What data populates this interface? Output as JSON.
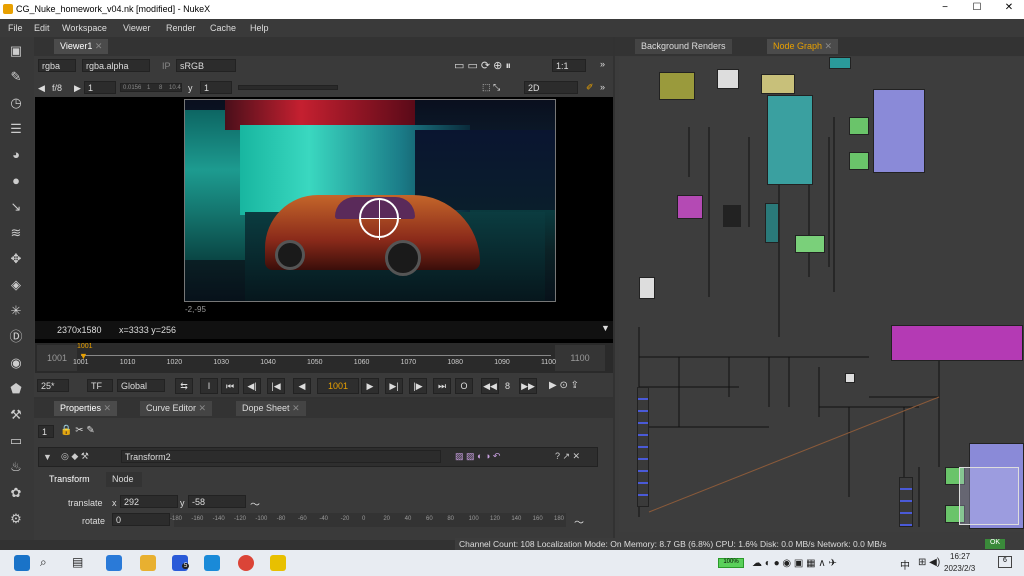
{
  "window": {
    "title": "CG_Nuke_homework_v04.nk [modified] - NukeX",
    "minimize": "−",
    "maximize": "☐",
    "close": "✕"
  },
  "menu": [
    "File",
    "Edit",
    "Workspace",
    "Viewer",
    "Render",
    "Cache",
    "Help"
  ],
  "viewer": {
    "tab": "Viewer1",
    "channels": "rgba",
    "alpha": "rgba.alpha",
    "ip": "IP",
    "lut": "sRGB",
    "fstop": "f/8",
    "gain": "1",
    "gamma_label": "y",
    "gamma": "1",
    "zoom": "1:1",
    "view_mode": "2D",
    "slider_marks": [
      "0.0156",
      "1",
      "8",
      "10.4"
    ],
    "coord_below": "-2,-95",
    "resolution": "2370x1580",
    "cursor": "x=3333 y=256"
  },
  "timeline": {
    "in": "1001",
    "out": "1100",
    "current": "1001",
    "ticks": [
      "1001",
      "1010",
      "1020",
      "1030",
      "1040",
      "1050",
      "1060",
      "1070",
      "1080",
      "1090",
      "1100"
    ]
  },
  "transport": {
    "fps": "25*",
    "tf": "TF",
    "range": "Global",
    "frame": "1001",
    "step": "8",
    "o_label": "O"
  },
  "props": {
    "tabs": [
      "Properties",
      "Curve Editor",
      "Dope Sheet"
    ],
    "count": "1",
    "node_name": "Transform2",
    "subtabs": [
      "Transform",
      "Node"
    ],
    "translate_label": "translate",
    "tx_label": "x",
    "tx": "292",
    "ty_label": "y",
    "ty": "-58",
    "rotate_label": "rotate",
    "rotate": "0",
    "rot_ticks": [
      "-180",
      "-160",
      "-140",
      "-120",
      "-100",
      "-80",
      "-60",
      "-40",
      "-20",
      "0",
      "20",
      "40",
      "60",
      "80",
      "100",
      "120",
      "140",
      "160",
      "180"
    ]
  },
  "graph_tabs": [
    "Background Renders",
    "Node Graph"
  ],
  "statusbar": "Channel Count: 108  Localization Mode: On  Memory: 8.7 GB (6.8%)  CPU: 1.6%  Disk: 0.0 MB/s  Network: 0.0 MB/s",
  "status_badge": "OK",
  "taskbar": {
    "time": "16:27",
    "date": "2023/2/3",
    "battery": "100%",
    "mail_badge": "5",
    "notif": "6",
    "ime": "中"
  }
}
